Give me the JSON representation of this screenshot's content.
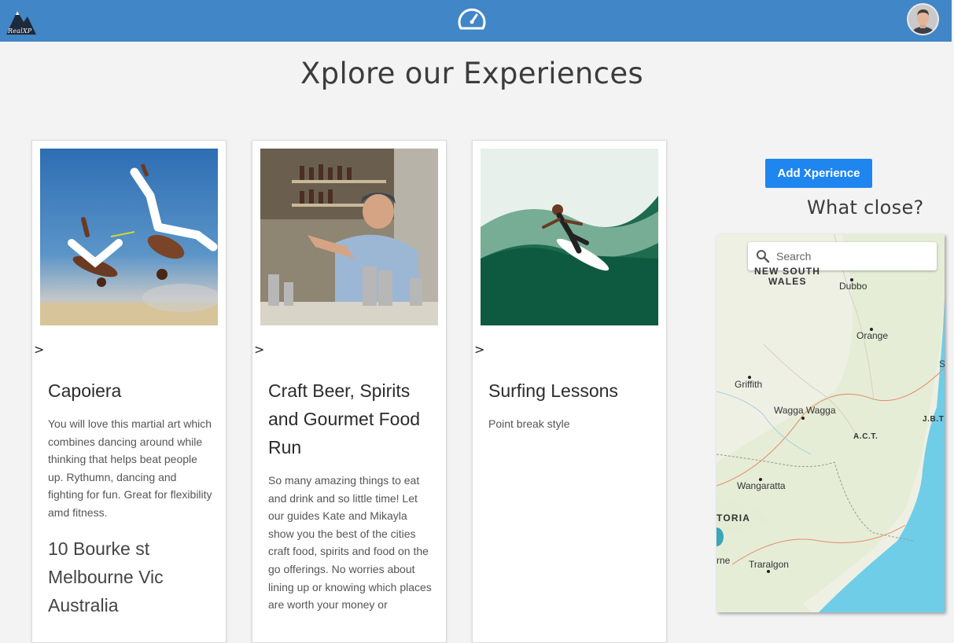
{
  "header": {
    "logo_text": "RealXP",
    "dashboard_icon": "speedometer-icon",
    "avatar_icon": "user-avatar",
    "bar_color": "#4186c6"
  },
  "page": {
    "title": "Xplore our Experiences"
  },
  "experiences": [
    {
      "arrow": ">",
      "title": "Capoiera",
      "description": "You will love this martial art which combines dancing around while thinking that helps beat people up. Rythumn, dancing and fighting for fun. Great for flexibility amd fitness.",
      "address": "10 Bourke st Melbourne Vic Australia"
    },
    {
      "arrow": ">",
      "title": "Craft Beer, Spirits and Gourmet Food Run",
      "description": "So many amazing things to eat and drink and so little time! Let our guides Kate and Mikayla show you the best of the cities craft food, spirits and food on the go offerings. No worries about lining up or knowing which places are worth your money or"
    },
    {
      "arrow": ">",
      "title": "Surfing Lessons",
      "description": "Point break style"
    }
  ],
  "sidebar": {
    "add_button_label": "Add Xperience",
    "add_button_color": "#1f86f0",
    "nearby_heading": "What close?",
    "map": {
      "search_placeholder": "Search",
      "search_icon": "search-icon",
      "labels": {
        "nsw_1": "NEW SOUTH",
        "nsw_2": "WALES",
        "dubbo": "Dubbo",
        "orange": "Orange",
        "griffith": "Griffith",
        "wagga": "Wagga Wagga",
        "act": "A.C.T.",
        "jbt": "J.B.T",
        "s": "S",
        "wangaratta": "Wangaratta",
        "victoria": "TORIA",
        "rne": "rne",
        "traralgon": "Traralgon"
      },
      "land_color": "#eef0e4",
      "water_color": "#6fcde8"
    }
  }
}
